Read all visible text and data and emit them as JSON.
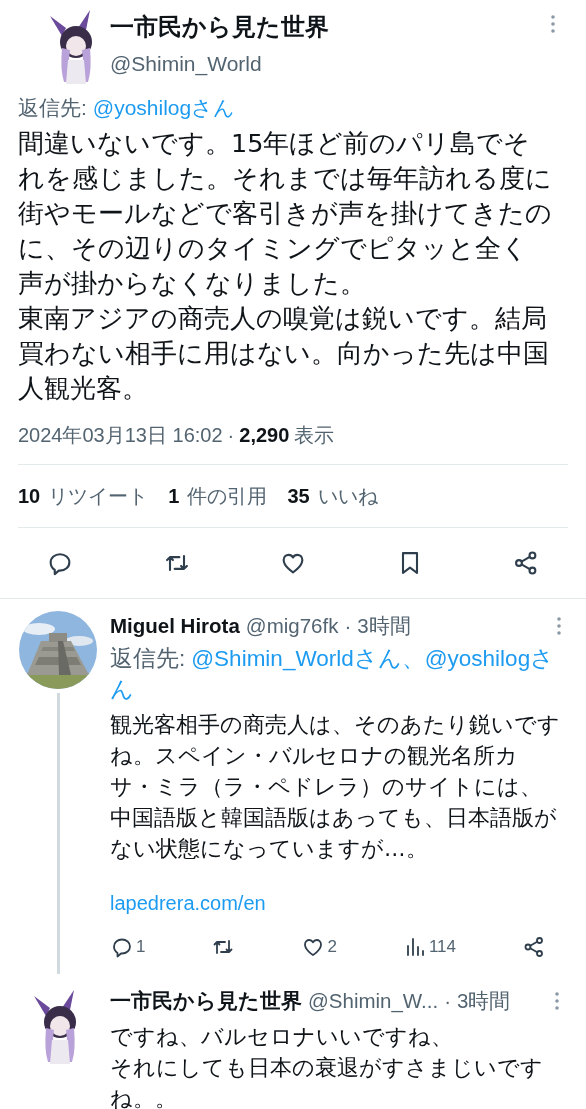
{
  "main_tweet": {
    "name": "一市民から見た世界",
    "handle": "@Shimin_World",
    "reply_label": "返信先:",
    "reply_to": [
      "@yoshilogさん"
    ],
    "body": [
      "間違いないです。15年ほど前のパリ島でそれを感じました。それまでは毎年訪れる度に街やモールなどで客引きが声を掛けてきたのに、その辺りのタイミングでピタッと全く声が掛からなくなりました。",
      "東南アジアの商売人の嗅覚は鋭いです。結局買わない相手に用はない。向かった先は中国人観光客。"
    ],
    "date": "2024年03月13日 16:02",
    "separator": "·",
    "views_count": "2,290",
    "views_label": "表示",
    "stats": [
      {
        "count": "10",
        "label": "リツイート"
      },
      {
        "count": "1",
        "label": "件の引用"
      },
      {
        "count": "35",
        "label": "いいね"
      }
    ],
    "actions": [
      {
        "kind": "reply"
      },
      {
        "kind": "retweet"
      },
      {
        "kind": "like"
      },
      {
        "kind": "bookmark"
      },
      {
        "kind": "share"
      }
    ]
  },
  "replies": [
    {
      "avatar": {
        "kind": "picture"
      },
      "name": "Miguel Hirota",
      "handle": "@mig76fk",
      "separator": "·",
      "time": "3時間",
      "reply_label": "返信先:",
      "reply_to": [
        "@Shimin_Worldさん、",
        "@yoshilogさん"
      ],
      "body": [
        "観光客相手の商売人は、そのあたり鋭いですね。スペイン・バルセロナの観光名所カサ・ミラ（ラ・ペドレラ）のサイトには、中国語版と韓国語版はあっても、日本語版がない状態になっていますが…。"
      ],
      "link": "lapedrera.com/en",
      "actions": [
        {
          "kind": "reply",
          "count": "1"
        },
        {
          "kind": "retweet"
        },
        {
          "kind": "like",
          "count": "2"
        },
        {
          "kind": "views",
          "count": "114"
        },
        {
          "kind": "share"
        }
      ],
      "thread_line": true
    },
    {
      "avatar": {
        "kind": "character"
      },
      "name": "一市民から見た世界",
      "handle": "@Shimin_W...",
      "separator": "·",
      "time": "3時間",
      "body": [
        "ですね、バルセロナいいですね、",
        "それにしても日本の衰退がすさまじいですね。。"
      ],
      "thread_line": false
    }
  ]
}
